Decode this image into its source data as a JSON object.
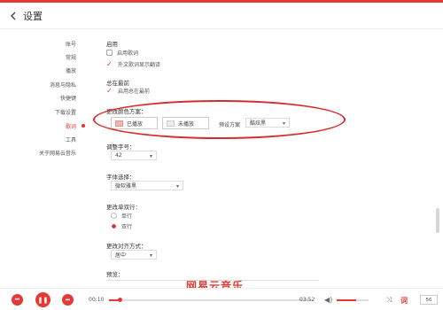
{
  "header": {
    "back_icon": "chevron-left-icon",
    "title": "设置"
  },
  "sidebar": {
    "items": [
      {
        "label": "账号",
        "active": false
      },
      {
        "label": "常规",
        "active": false
      },
      {
        "label": "播放",
        "active": false
      },
      {
        "label": "消息与隐私",
        "active": false
      },
      {
        "label": "快捷键",
        "active": false
      },
      {
        "label": "下载设置",
        "active": false
      },
      {
        "label": "歌词",
        "active": true
      },
      {
        "label": "工具",
        "active": false
      },
      {
        "label": "关于网易云音乐",
        "active": false
      }
    ]
  },
  "lyrics": {
    "enable": {
      "title": "启用",
      "opt1": "启用歌词",
      "opt2": "外文歌词显示翻译"
    },
    "ontop": {
      "title": "总在最前",
      "opt1": "启用总在最前"
    },
    "color": {
      "title": "更改颜色方案：",
      "played": "已播放",
      "unplayed": "未播放",
      "preset_label": "预设方案",
      "preset_value": "酷炫黑"
    },
    "fontsize": {
      "title": "调整字号：",
      "value": "42"
    },
    "font": {
      "title": "字体选择：",
      "value": "微软雅黑"
    },
    "lines": {
      "title": "更改单双行：",
      "single": "单行",
      "double": "双行"
    },
    "align": {
      "title": "更改对齐方式：",
      "value": "居中"
    },
    "preview": {
      "title": "预览：",
      "text": "网易云音乐"
    }
  },
  "player": {
    "current_time": "00:10",
    "total_time": "03:52",
    "progress": 0.05,
    "volume": 0.6,
    "playlist_count": "56",
    "colors": {
      "accent": "#e53935"
    }
  }
}
